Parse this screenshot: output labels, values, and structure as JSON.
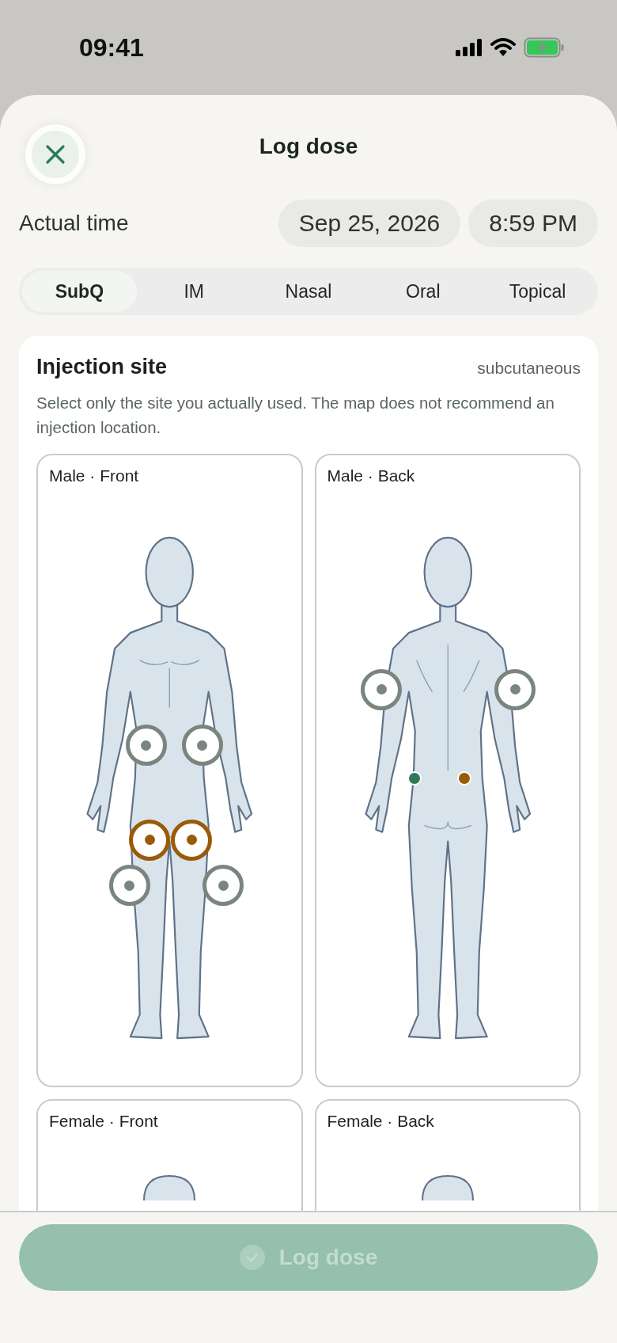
{
  "status_bar": {
    "time": "09:41"
  },
  "header": {
    "title": "Log dose"
  },
  "actual_time": {
    "label": "Actual time",
    "date": "Sep 25, 2026",
    "time": "8:59 PM"
  },
  "routes": [
    {
      "label": "SubQ",
      "selected": true
    },
    {
      "label": "IM",
      "selected": false
    },
    {
      "label": "Nasal",
      "selected": false
    },
    {
      "label": "Oral",
      "selected": false
    },
    {
      "label": "Topical",
      "selected": false
    }
  ],
  "injection_site": {
    "title": "Injection site",
    "route_note": "subcutaneous",
    "description": "Select only the site you actually used. The map does not recommend an injection location.",
    "maps": [
      {
        "label": "Male · Front",
        "kind": "front",
        "sites": [
          {
            "kind": "ring",
            "color": "#7b8580"
          },
          {
            "kind": "ring",
            "color": "#7b8580"
          },
          {
            "kind": "ring",
            "color": "#9a5b08"
          },
          {
            "kind": "ring",
            "color": "#9a5b08"
          },
          {
            "kind": "ring",
            "color": "#7b8580"
          },
          {
            "kind": "ring",
            "color": "#7b8580"
          }
        ]
      },
      {
        "label": "Male · Back",
        "kind": "back",
        "sites": [
          {
            "kind": "ring",
            "color": "#7b8580"
          },
          {
            "kind": "ring",
            "color": "#7b8580"
          },
          {
            "kind": "dot",
            "color": "#2e7a58"
          },
          {
            "kind": "dot",
            "color": "#9a5b08"
          }
        ]
      },
      {
        "label": "Female · Front",
        "kind": "partial"
      },
      {
        "label": "Female · Back",
        "kind": "partial"
      }
    ]
  },
  "submit": {
    "label": "Log dose",
    "disabled": true
  }
}
